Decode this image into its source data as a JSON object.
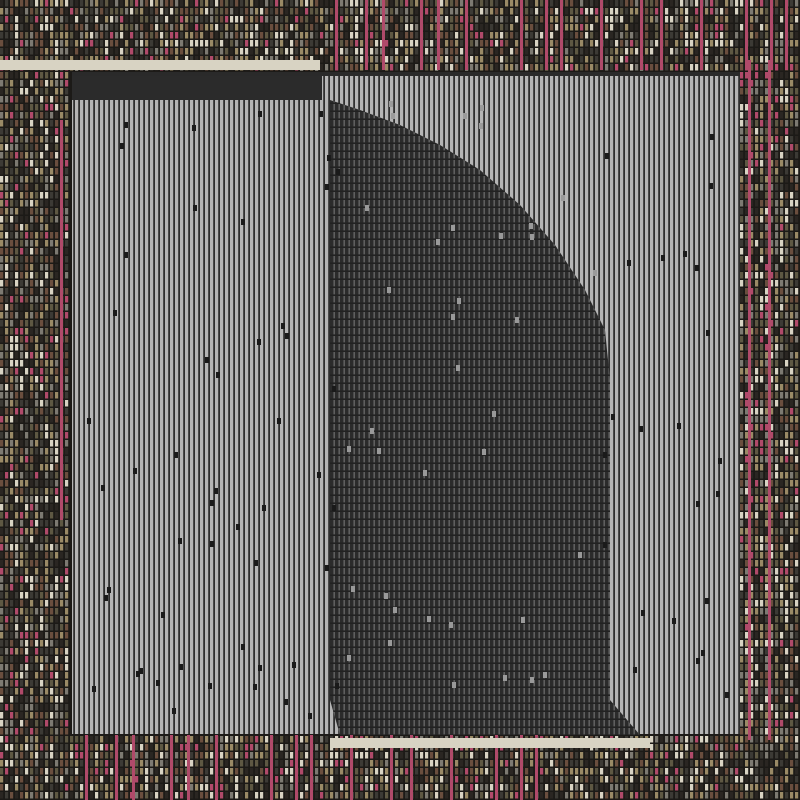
{
  "palette": {
    "background": "#1c1a17",
    "frame_dark": "#2a2622",
    "frame_olive": "#5e5843",
    "frame_tan": "#9a8a66",
    "frame_cream": "#d8d3c3",
    "accent_pink": "#b04a6a",
    "accent_brown": "#6a4e3e",
    "panel_light_stripe": "#b9b9b9",
    "panel_dark_stripe": "#2b2b2b",
    "shape_dark": "#2e2e2e",
    "shape_stripe": "#5d5d5d",
    "speckle": "#1a1a1a"
  },
  "artwork": {
    "description_free": true,
    "has_outer_frame": true,
    "has_inner_panel": true,
    "has_dark_shape": true,
    "stripe_orientation": "vertical"
  }
}
